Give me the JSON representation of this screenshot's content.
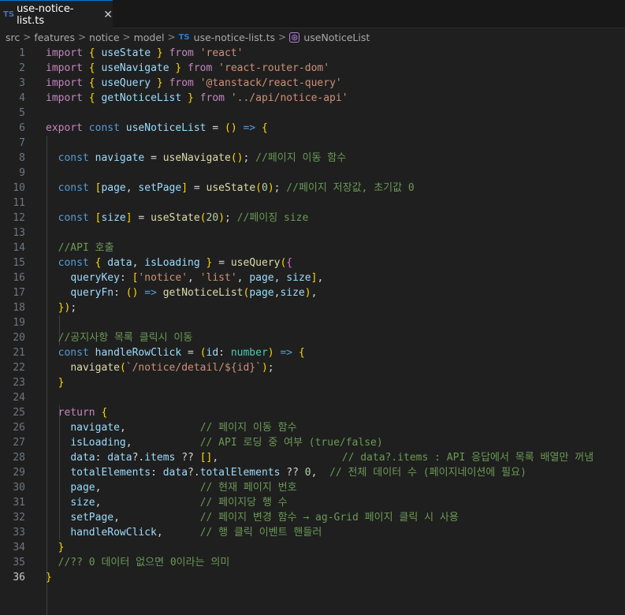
{
  "tab": {
    "icon": "TS",
    "title": "use-notice-list.ts",
    "close_glyph": "✕"
  },
  "breadcrumb": {
    "items": [
      "src",
      "features",
      "notice",
      "model"
    ],
    "file_icon": "TS",
    "file": "use-notice-list.ts",
    "symbol_icon": "⊛",
    "symbol": "useNoticeList"
  },
  "editor": {
    "active_line": 36,
    "line_numbers": [
      "1",
      "2",
      "3",
      "4",
      "5",
      "6",
      "7",
      "8",
      "9",
      "10",
      "11",
      "12",
      "13",
      "14",
      "15",
      "16",
      "17",
      "18",
      "19",
      "20",
      "21",
      "22",
      "23",
      "24",
      "25",
      "26",
      "27",
      "28",
      "29",
      "30",
      "31",
      "32",
      "33",
      "34",
      "35",
      "36"
    ],
    "lines": [
      "import { useState } from 'react'",
      "import { useNavigate } from 'react-router-dom'",
      "import { useQuery } from '@tanstack/react-query'",
      "import { getNoticeList } from '../api/notice-api'",
      "",
      "export const useNoticeList = () => {",
      "",
      "  const navigate = useNavigate(); //페이지 이동 함수",
      "",
      "  const [page, setPage] = useState(0); //페이지 저장값, 초기값 0",
      "",
      "  const [size] = useState(20); //페이징 size",
      "",
      "  //API 호출",
      "  const { data, isLoading } = useQuery({",
      "    queryKey: ['notice', 'list', page, size],",
      "    queryFn: () => getNoticeList(page,size),",
      "  });",
      "",
      "  //공지사항 목록 클릭시 이동",
      "  const handleRowClick = (id: number) => {",
      "    navigate(`/notice/detail/${id}`);",
      "  }",
      "",
      "  return {",
      "    navigate,            // 페이지 이동 함수",
      "    isLoading,           // API 로딩 중 여부 (true/false)",
      "    data: data?.items ?? [],                    // data?.items : API 응답에서 목록 배열만 꺼냄",
      "    totalElements: data?.totalElements ?? 0,  // 전체 데이터 수 (페이지네이션에 필요)",
      "    page,                // 현재 페이지 번호",
      "    size,                // 페이지당 행 수",
      "    setPage,             // 페이지 변경 함수 → ag-Grid 페이지 클릭 시 사용",
      "    handleRowClick,      // 행 클릭 이벤트 핸들러",
      "  }",
      "  //?? 0 데이터 없으면 0이라는 의미",
      "}"
    ]
  }
}
